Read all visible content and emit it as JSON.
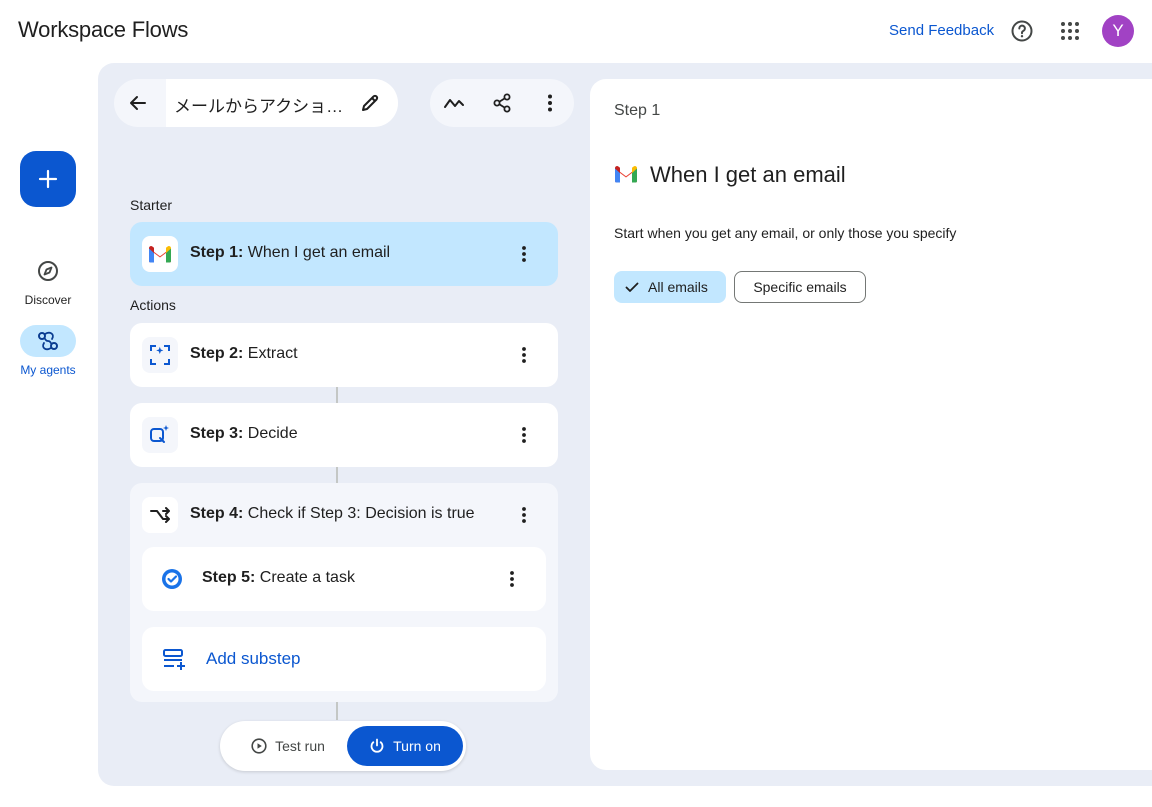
{
  "app": {
    "title": "Workspace Flows"
  },
  "header": {
    "send_feedback": "Send Feedback",
    "avatar_letter": "Y",
    "avatar_color": "#a142c4"
  },
  "nav": {
    "items": [
      {
        "label": "Discover",
        "icon": "compass-icon",
        "active": false
      },
      {
        "label": "My agents",
        "icon": "agents-icon",
        "active": true
      }
    ]
  },
  "flow": {
    "name": "メールからアクション…"
  },
  "sections": {
    "starter": "Starter",
    "actions": "Actions"
  },
  "steps": [
    {
      "prefix": "Step 1:",
      "text": "When I get an email",
      "icon": "gmail-icon",
      "selected": true
    },
    {
      "prefix": "Step 2:",
      "text": "Extract",
      "icon": "extract-icon"
    },
    {
      "prefix": "Step 3:",
      "text": "Decide",
      "icon": "decide-icon"
    },
    {
      "prefix": "Step 4:",
      "text": "Check if Step 3: Decision is true",
      "icon": "condition-icon"
    },
    {
      "prefix": "Step 5:",
      "text": "Create a task",
      "icon": "tasks-icon"
    }
  ],
  "add_substep": "Add substep",
  "runbar": {
    "test_run": "Test run",
    "turn_on": "Turn on"
  },
  "panel": {
    "step_label": "Step 1",
    "title": "When I get an email",
    "description": "Start when you get any email, or only those you specify",
    "chips": {
      "all": "All emails",
      "specific": "Specific emails"
    }
  },
  "colors": {
    "primary": "#0b57d0",
    "selected": "#c2e7ff",
    "canvas": "#e9edf6"
  }
}
